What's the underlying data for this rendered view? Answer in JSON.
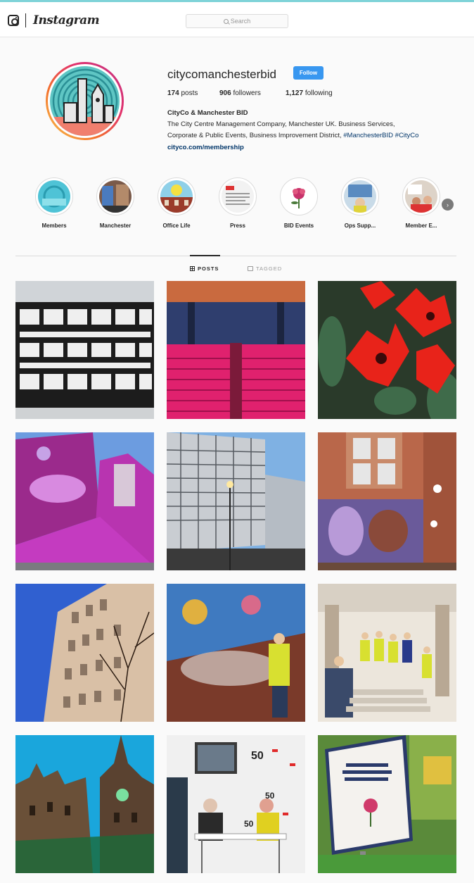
{
  "nav": {
    "wordmark": "Instagram",
    "search_placeholder": "Search",
    "logo_icon": "instagram-camera-icon"
  },
  "profile": {
    "username": "citycomanchesterbid",
    "follow_label": "Follow",
    "stats": [
      {
        "value": "174",
        "label": "posts"
      },
      {
        "value": "906",
        "label": "followers"
      },
      {
        "value": "1,127",
        "label": "following"
      }
    ],
    "full_name": "CityCo & Manchester BID",
    "bio_line1": "The City Centre Management Company, Manchester UK. Business Services,",
    "bio_line2_text": "Corporate & Public Events, Business Improvement District,",
    "bio_hashtags": "#ManchesterBID #CityCo",
    "website": "cityco.com/membership"
  },
  "highlights": [
    {
      "label": "Members"
    },
    {
      "label": "Manchester"
    },
    {
      "label": "Office Life"
    },
    {
      "label": "Press"
    },
    {
      "label": "BID Events"
    },
    {
      "label": "Ops Supp..."
    },
    {
      "label": "Member E..."
    }
  ],
  "tabs": [
    {
      "label": "POSTS",
      "icon": "grid-icon",
      "active": true
    },
    {
      "label": "TAGGED",
      "icon": "tag-icon",
      "active": false
    }
  ],
  "colors": {
    "follow_button": "#3897f0",
    "link": "#003569",
    "accent_bar": "#7fd3d8"
  }
}
